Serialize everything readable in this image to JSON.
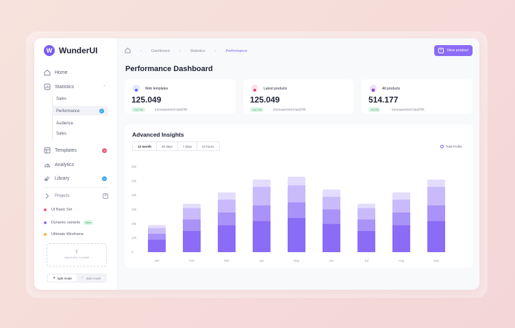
{
  "app": {
    "name": "WunderUI",
    "logo_letter": "W"
  },
  "sidebar": {
    "nav": [
      {
        "label": "Home",
        "icon": "home-icon"
      },
      {
        "label": "Statistics",
        "icon": "chart-icon"
      },
      {
        "label": "Templates",
        "icon": "template-icon",
        "badge": "9",
        "badge_color": "#f0567a"
      },
      {
        "label": "Analytics",
        "icon": "analytics-icon"
      },
      {
        "label": "Library",
        "icon": "library-icon",
        "badge": "9",
        "badge_color": "#3ba7f0"
      }
    ],
    "statistics_sub": [
      {
        "label": "Sales"
      },
      {
        "label": "Performance",
        "badge": "2",
        "badge_color": "#3ba7f0"
      },
      {
        "label": "Audience"
      },
      {
        "label": "Sales"
      }
    ],
    "projects_label": "Projects",
    "projects": [
      {
        "label": "UI Basic Set",
        "color": "#f0567a"
      },
      {
        "label": "Dynamic variants",
        "color": "#8b6cf6",
        "tag": "New"
      },
      {
        "label": "Ultimate Wireframe",
        "color": "#f7b32b"
      }
    ],
    "upload_text": "drag to drop / to update",
    "modes": {
      "light": "light mode",
      "dark": "dark mode"
    }
  },
  "breadcrumb": [
    "Dashboard",
    "Statistics",
    "Performance"
  ],
  "header": {
    "new_button": "New product",
    "title": "Performance Dashboard"
  },
  "cards": [
    {
      "label": "Web templates",
      "value": "125.049",
      "delta": "+12.7%",
      "note": "increasement last24h",
      "icon_color": "#5b6cf6"
    },
    {
      "label": "Latest products",
      "value": "125.049",
      "delta": "+12.7%",
      "note": "increasement last24h",
      "icon_color": "#e14b82"
    },
    {
      "label": "All products",
      "value": "514.177",
      "delta": "+5.7%",
      "note": "increasement last24h",
      "icon_color": "#8b4cd6"
    }
  ],
  "insights": {
    "title": "Advanced Insights",
    "tabs": [
      "12 month",
      "30 days",
      "7 days",
      "24 hours"
    ],
    "active_tab": 0,
    "legend": "Total Profits"
  },
  "chart_data": {
    "type": "bar",
    "stacked": true,
    "categories": [
      "Jan",
      "Feb",
      "Mar",
      "Apr",
      "May",
      "Jun",
      "Jul",
      "Aug",
      "Sep"
    ],
    "series": [
      {
        "values": [
          9,
          15,
          19,
          22,
          24,
          20,
          15,
          19,
          22
        ],
        "color": "#8b6cf6"
      },
      {
        "values": [
          4,
          8,
          9,
          11,
          11,
          10,
          8,
          9,
          11
        ],
        "color": "#a992f8"
      },
      {
        "values": [
          4,
          8,
          9,
          13,
          12,
          9,
          8,
          9,
          13
        ],
        "color": "#c9bbfb"
      },
      {
        "values": [
          2,
          3,
          5,
          5,
          6,
          5,
          3,
          5,
          5
        ],
        "color": "#e4dcfd"
      }
    ],
    "yticks": [
      "0",
      "10k",
      "20k",
      "30k",
      "40k",
      "50k",
      "60k"
    ],
    "ylim": [
      0,
      60
    ],
    "grid": false
  }
}
